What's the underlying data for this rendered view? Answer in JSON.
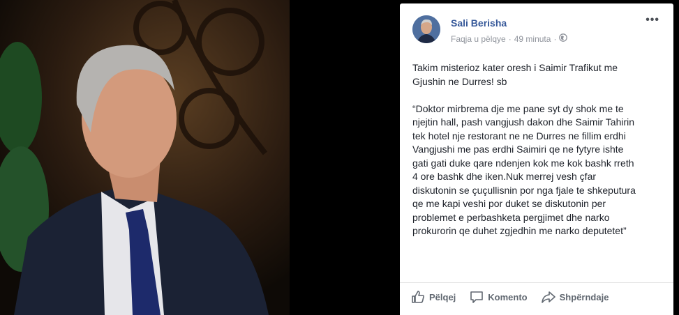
{
  "post": {
    "author": "Sali Berisha",
    "meta_page": "Faqja u pëlqye",
    "meta_sep": "·",
    "meta_time": "49 minuta",
    "meta_sep2": "·",
    "more": "•••",
    "text": "Takim misterioz kater oresh i Saimir Trafikut me\nGjushin ne Durres! sb\n\n“Doktor mirbrema dje me pane syt dy shok me te\nnjejtin hall, pash vangjush dakon dhe Saimir Tahirin\ntek hotel nje restorant ne ne Durres ne fillim erdhi\nVangjushi me pas erdhi Saimiri qe ne fytyre ishte\ngati gati duke qare ndenjen kok me kok bashk rreth\n4 ore bashk dhe iken.Nuk merrej vesh çfar\ndiskutonin se çuçullisnin por nga fjale te shkeputura\nqe me kapi veshi por duket se diskutonin per\nproblemet e perbashketa pergjimet dhe narko\nprokurorin qe duhet zgjedhin me narko deputetet”"
  },
  "actions": {
    "like": "Pëlqej",
    "comment": "Komento",
    "share": "Shpërndaje"
  },
  "icons": [
    "globe-icon",
    "like-icon",
    "comment-icon",
    "share-icon"
  ]
}
